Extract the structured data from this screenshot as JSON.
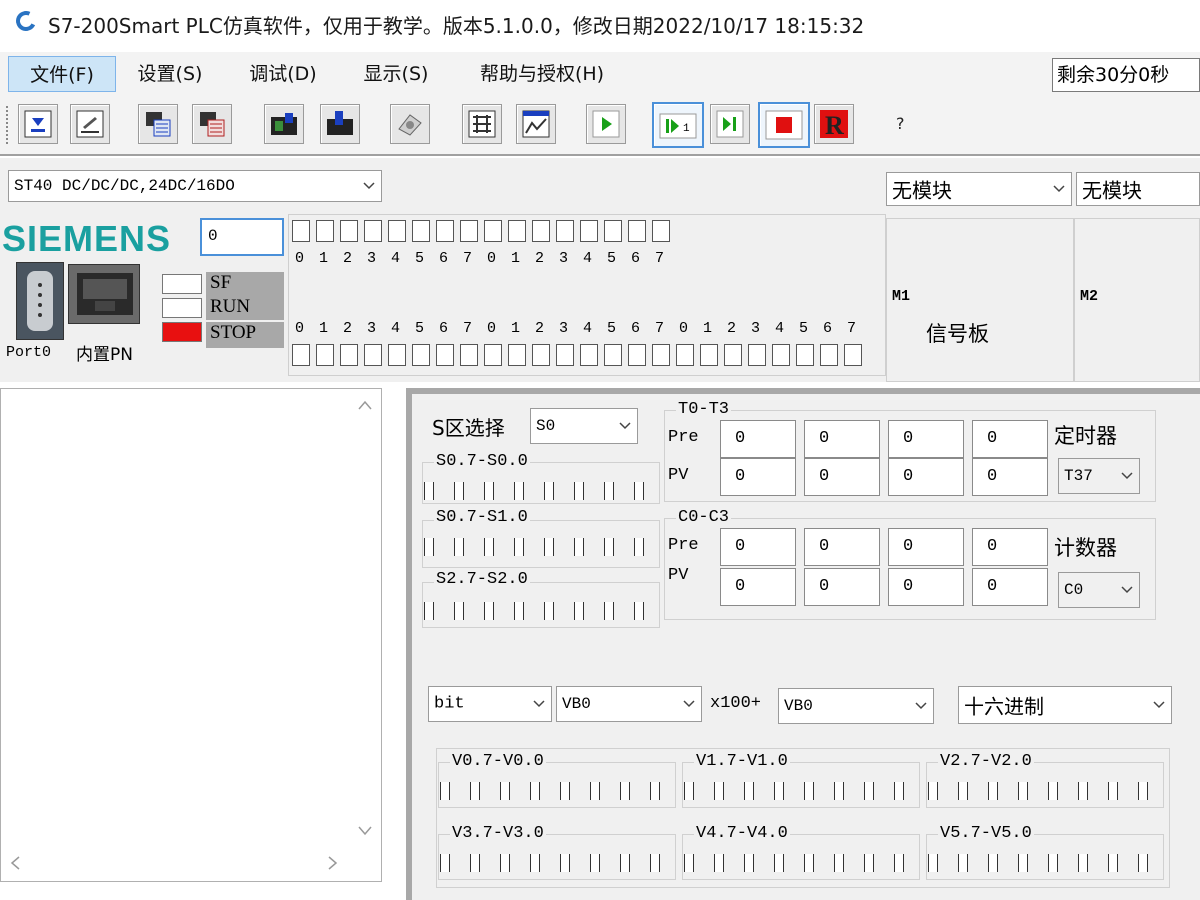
{
  "window": {
    "title": "S7-200Smart PLC仿真软件，仅用于教学。版本5.1.0.0，修改日期2022/10/17 18:15:32"
  },
  "menu": {
    "file": "文件(F)",
    "settings": "设置(S)",
    "debug": "调试(D)",
    "view": "显示(S)",
    "help": "帮助与授权(H)"
  },
  "timer": "剩余30分0秒",
  "toolbar": {
    "help": "?"
  },
  "cpu": {
    "model": "ST40 DC/DC/DC,24DC/16DO",
    "brand": "SIEMENS",
    "address": "0"
  },
  "ports": {
    "port0": "Port0",
    "builtin_pn": "内置PN"
  },
  "status": {
    "sf": "SF",
    "run": "RUN",
    "stop": "STOP"
  },
  "digits": [
    "0",
    "1",
    "2",
    "3",
    "4",
    "5",
    "6",
    "7"
  ],
  "modules": {
    "m1_select": "无模块",
    "m2_select": "无模块",
    "m1": "M1",
    "m2": "M2",
    "signal_board": "信号板"
  },
  "s_area": {
    "label": "S区选择",
    "select": "S0",
    "g1": "S0.7-S0.0",
    "g2": "S0.7-S1.0",
    "g3": "S2.7-S2.0"
  },
  "timers": {
    "group": "T0-T3",
    "pre": "Pre",
    "pv": "PV",
    "label": "定时器",
    "select": "T37",
    "pre_values": [
      "0",
      "0",
      "0",
      "0"
    ],
    "pv_values": [
      "0",
      "0",
      "0",
      "0"
    ]
  },
  "counters": {
    "group": "C0-C3",
    "pre": "Pre",
    "pv": "PV",
    "label": "计数器",
    "select": "C0",
    "pre_values": [
      "0",
      "0",
      "0",
      "0"
    ],
    "pv_values": [
      "0",
      "0",
      "0",
      "0"
    ]
  },
  "vmem": {
    "type": "bit",
    "base": "VB0",
    "multiplier": "x100+",
    "offset": "VB0",
    "format": "十六进制",
    "groups": [
      "V0.7-V0.0",
      "V1.7-V1.0",
      "V2.7-V2.0",
      "V3.7-V3.0",
      "V4.7-V4.0",
      "V5.7-V5.0"
    ]
  }
}
